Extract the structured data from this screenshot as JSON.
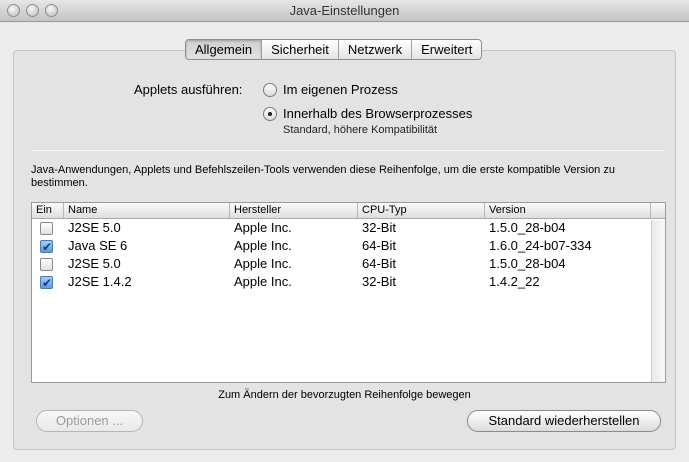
{
  "window": {
    "title": "Java-Einstellungen"
  },
  "tabs": [
    {
      "label": "Allgemein",
      "active": true
    },
    {
      "label": "Sicherheit",
      "active": false
    },
    {
      "label": "Netzwerk",
      "active": false
    },
    {
      "label": "Erweitert",
      "active": false
    }
  ],
  "applets": {
    "label": "Applets ausführen:",
    "options": [
      {
        "label": "Im eigenen Prozess",
        "selected": false
      },
      {
        "label": "Innerhalb des Browserprozesses",
        "selected": true
      }
    ],
    "note": "Standard, höhere Kompatibilität"
  },
  "description": "Java-Anwendungen, Applets und Befehlszeilen-Tools verwenden diese Reihenfolge, um die erste kompatible Version zu bestimmen.",
  "table": {
    "headers": [
      "Ein",
      "Name",
      "Hersteller",
      "CPU-Typ",
      "Version"
    ],
    "rows": [
      {
        "enabled": false,
        "name": "J2SE 5.0",
        "vendor": "Apple Inc.",
        "cpu": "32-Bit",
        "version": "1.5.0_28-b04"
      },
      {
        "enabled": true,
        "name": "Java SE 6",
        "vendor": "Apple Inc.",
        "cpu": "64-Bit",
        "version": "1.6.0_24-b07-334"
      },
      {
        "enabled": false,
        "name": "J2SE 5.0",
        "vendor": "Apple Inc.",
        "cpu": "64-Bit",
        "version": "1.5.0_28-b04"
      },
      {
        "enabled": true,
        "name": "J2SE 1.4.2",
        "vendor": "Apple Inc.",
        "cpu": "32-Bit",
        "version": "1.4.2_22"
      }
    ]
  },
  "hint": "Zum Ändern der bevorzugten Reihenfolge bewegen",
  "buttons": {
    "options": "Optionen ...",
    "restore": "Standard wiederherstellen"
  }
}
